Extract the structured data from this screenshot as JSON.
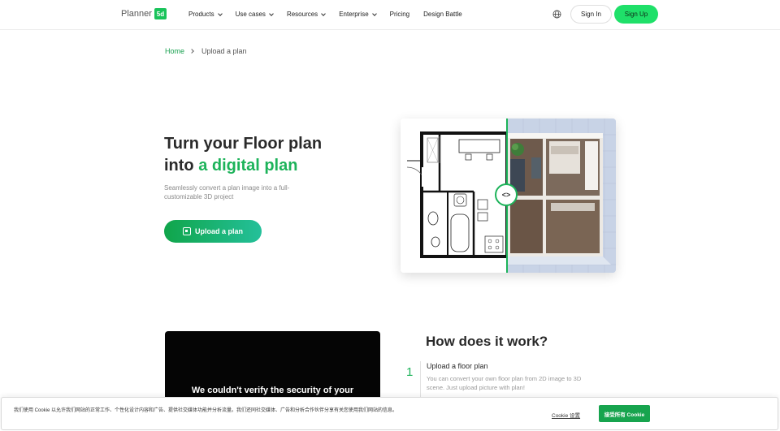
{
  "header": {
    "logo_text": "Planner",
    "logo_badge": "5d",
    "nav": [
      {
        "label": "Products"
      },
      {
        "label": "Use cases"
      },
      {
        "label": "Resources"
      },
      {
        "label": "Enterprise"
      },
      {
        "label": "Pricing"
      },
      {
        "label": "Design Battle"
      }
    ],
    "sign_in": "Sign In",
    "sign_up": "Sign Up"
  },
  "breadcrumb": {
    "home": "Home",
    "current": "Upload a plan"
  },
  "hero": {
    "title_line1": "Turn your Floor plan",
    "title_line2_prefix": "into ",
    "title_line2_accent": "a digital plan",
    "subtitle": "Seamlessly convert a plan image into a full-customizable 3D project",
    "upload_button": "Upload a plan",
    "compare_handle": "<>"
  },
  "how": {
    "title": "How does it work?",
    "video_text": "We couldn't verify the security of your",
    "steps": [
      {
        "number": "1",
        "title": "Upload a floor plan",
        "desc": "You can convert your own floor plan from 2D image to 3D scene. Just upload picture with plan!"
      }
    ]
  },
  "cookie": {
    "text": "我们使用 Cookie 以允许我们网站的正常工作、个性化设计内容和广告、提供社交媒体功能并分析流量。我们还同社交媒体、广告和分析合作伙伴分享有关您使用我们网站的信息。",
    "settings": "Cookie 设置",
    "accept": "接受所有 Cookie"
  },
  "colors": {
    "brand_green": "#1db35a",
    "signup_green": "#1fe069",
    "cookie_green": "#17a44e"
  }
}
